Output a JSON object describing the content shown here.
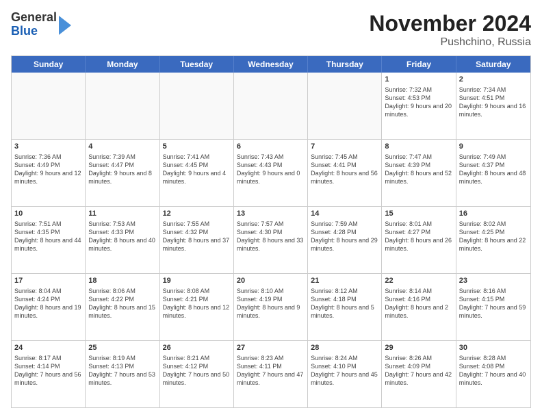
{
  "header": {
    "logo_line1": "General",
    "logo_line2": "Blue",
    "title": "November 2024",
    "subtitle": "Pushchino, Russia"
  },
  "days_of_week": [
    "Sunday",
    "Monday",
    "Tuesday",
    "Wednesday",
    "Thursday",
    "Friday",
    "Saturday"
  ],
  "weeks": [
    [
      {
        "day": "",
        "empty": true
      },
      {
        "day": "",
        "empty": true
      },
      {
        "day": "",
        "empty": true
      },
      {
        "day": "",
        "empty": true
      },
      {
        "day": "",
        "empty": true
      },
      {
        "day": "1",
        "sunrise": "7:32 AM",
        "sunset": "4:53 PM",
        "daylight": "9 hours and 20 minutes."
      },
      {
        "day": "2",
        "sunrise": "7:34 AM",
        "sunset": "4:51 PM",
        "daylight": "9 hours and 16 minutes."
      }
    ],
    [
      {
        "day": "3",
        "sunrise": "7:36 AM",
        "sunset": "4:49 PM",
        "daylight": "9 hours and 12 minutes."
      },
      {
        "day": "4",
        "sunrise": "7:39 AM",
        "sunset": "4:47 PM",
        "daylight": "9 hours and 8 minutes."
      },
      {
        "day": "5",
        "sunrise": "7:41 AM",
        "sunset": "4:45 PM",
        "daylight": "9 hours and 4 minutes."
      },
      {
        "day": "6",
        "sunrise": "7:43 AM",
        "sunset": "4:43 PM",
        "daylight": "9 hours and 0 minutes."
      },
      {
        "day": "7",
        "sunrise": "7:45 AM",
        "sunset": "4:41 PM",
        "daylight": "8 hours and 56 minutes."
      },
      {
        "day": "8",
        "sunrise": "7:47 AM",
        "sunset": "4:39 PM",
        "daylight": "8 hours and 52 minutes."
      },
      {
        "day": "9",
        "sunrise": "7:49 AM",
        "sunset": "4:37 PM",
        "daylight": "8 hours and 48 minutes."
      }
    ],
    [
      {
        "day": "10",
        "sunrise": "7:51 AM",
        "sunset": "4:35 PM",
        "daylight": "8 hours and 44 minutes."
      },
      {
        "day": "11",
        "sunrise": "7:53 AM",
        "sunset": "4:33 PM",
        "daylight": "8 hours and 40 minutes."
      },
      {
        "day": "12",
        "sunrise": "7:55 AM",
        "sunset": "4:32 PM",
        "daylight": "8 hours and 37 minutes."
      },
      {
        "day": "13",
        "sunrise": "7:57 AM",
        "sunset": "4:30 PM",
        "daylight": "8 hours and 33 minutes."
      },
      {
        "day": "14",
        "sunrise": "7:59 AM",
        "sunset": "4:28 PM",
        "daylight": "8 hours and 29 minutes."
      },
      {
        "day": "15",
        "sunrise": "8:01 AM",
        "sunset": "4:27 PM",
        "daylight": "8 hours and 26 minutes."
      },
      {
        "day": "16",
        "sunrise": "8:02 AM",
        "sunset": "4:25 PM",
        "daylight": "8 hours and 22 minutes."
      }
    ],
    [
      {
        "day": "17",
        "sunrise": "8:04 AM",
        "sunset": "4:24 PM",
        "daylight": "8 hours and 19 minutes."
      },
      {
        "day": "18",
        "sunrise": "8:06 AM",
        "sunset": "4:22 PM",
        "daylight": "8 hours and 15 minutes."
      },
      {
        "day": "19",
        "sunrise": "8:08 AM",
        "sunset": "4:21 PM",
        "daylight": "8 hours and 12 minutes."
      },
      {
        "day": "20",
        "sunrise": "8:10 AM",
        "sunset": "4:19 PM",
        "daylight": "8 hours and 9 minutes."
      },
      {
        "day": "21",
        "sunrise": "8:12 AM",
        "sunset": "4:18 PM",
        "daylight": "8 hours and 5 minutes."
      },
      {
        "day": "22",
        "sunrise": "8:14 AM",
        "sunset": "4:16 PM",
        "daylight": "8 hours and 2 minutes."
      },
      {
        "day": "23",
        "sunrise": "8:16 AM",
        "sunset": "4:15 PM",
        "daylight": "7 hours and 59 minutes."
      }
    ],
    [
      {
        "day": "24",
        "sunrise": "8:17 AM",
        "sunset": "4:14 PM",
        "daylight": "7 hours and 56 minutes."
      },
      {
        "day": "25",
        "sunrise": "8:19 AM",
        "sunset": "4:13 PM",
        "daylight": "7 hours and 53 minutes."
      },
      {
        "day": "26",
        "sunrise": "8:21 AM",
        "sunset": "4:12 PM",
        "daylight": "7 hours and 50 minutes."
      },
      {
        "day": "27",
        "sunrise": "8:23 AM",
        "sunset": "4:11 PM",
        "daylight": "7 hours and 47 minutes."
      },
      {
        "day": "28",
        "sunrise": "8:24 AM",
        "sunset": "4:10 PM",
        "daylight": "7 hours and 45 minutes."
      },
      {
        "day": "29",
        "sunrise": "8:26 AM",
        "sunset": "4:09 PM",
        "daylight": "7 hours and 42 minutes."
      },
      {
        "day": "30",
        "sunrise": "8:28 AM",
        "sunset": "4:08 PM",
        "daylight": "7 hours and 40 minutes."
      }
    ]
  ]
}
